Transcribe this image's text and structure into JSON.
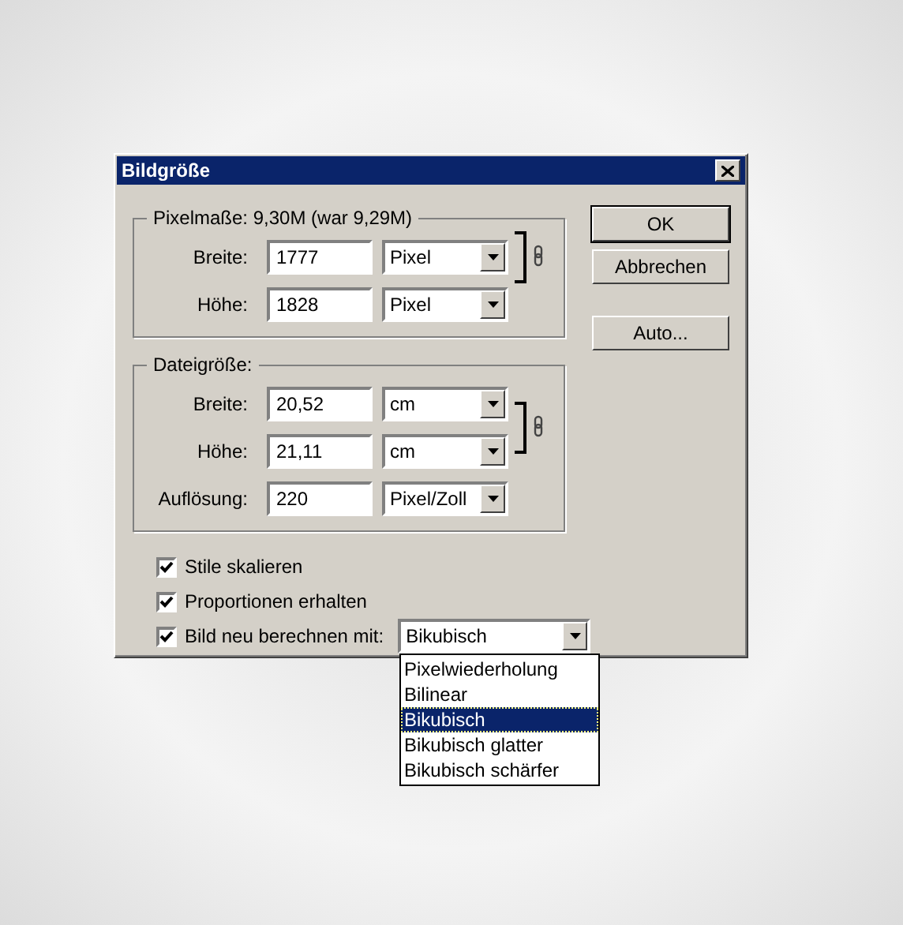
{
  "window": {
    "title": "Bildgröße"
  },
  "pixel_dimensions": {
    "legend": "Pixelmaße: 9,30M (war 9,29M)",
    "linked": true,
    "rows": [
      {
        "label": "Breite:",
        "value": "1777",
        "unit": "Pixel"
      },
      {
        "label": "Höhe:",
        "value": "1828",
        "unit": "Pixel"
      }
    ]
  },
  "document_size": {
    "legend": "Dateigröße:",
    "linked": true,
    "rows": [
      {
        "label": "Breite:",
        "value": "20,52",
        "unit": "cm"
      },
      {
        "label": "Höhe:",
        "value": "21,11",
        "unit": "cm"
      }
    ],
    "resolution": {
      "label": "Auflösung:",
      "value": "220",
      "unit": "Pixel/Zoll"
    }
  },
  "buttons": [
    {
      "label": "OK",
      "kind": "default"
    },
    {
      "label": "Abbrechen",
      "kind": "normal"
    },
    {
      "label": "Auto...",
      "kind": "normal"
    }
  ],
  "options": [
    {
      "label": "Stile skalieren",
      "checked": true
    },
    {
      "label": "Proportionen erhalten",
      "checked": true
    }
  ],
  "resample": {
    "label": "Bild neu berechnen mit:",
    "checked": true,
    "value": "Bikubisch",
    "expanded": true,
    "items": [
      {
        "label": "Pixelwiederholung",
        "selected": false
      },
      {
        "label": "Bilinear",
        "selected": false
      },
      {
        "label": "Bikubisch",
        "selected": true
      },
      {
        "label": "Bikubisch glatter",
        "selected": false
      },
      {
        "label": "Bikubisch schärfer",
        "selected": false
      }
    ]
  }
}
